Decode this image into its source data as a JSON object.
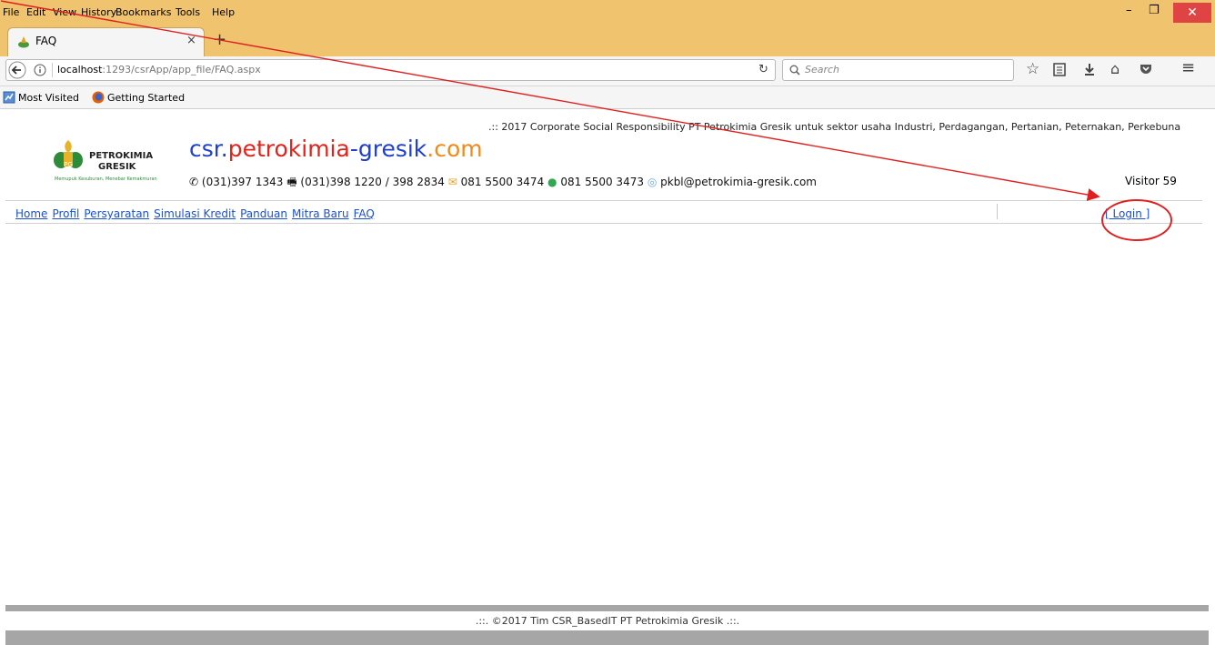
{
  "menubar": {
    "items": [
      "File",
      "Edit",
      "View",
      "History",
      "Bookmarks",
      "Tools",
      "Help"
    ]
  },
  "tab": {
    "title": "FAQ"
  },
  "urlbar": {
    "host": "localhost",
    "path": ":1293/csrApp/app_file/FAQ.aspx"
  },
  "search": {
    "placeholder": "Search"
  },
  "bookmarks": {
    "items": [
      "Most Visited",
      "Getting Started"
    ]
  },
  "page": {
    "tagline": ".:: 2017 Corporate Social Responsibility PT Petrokimia Gresik untuk sektor usaha Industri, Perdagangan, Pertanian, Peternakan, Perkebuna",
    "logo": {
      "line1": "PETROKIMIA",
      "line2": "GRESIK",
      "motto": "Memupuk Kesuburan, Menebar Kemakmuran",
      "badge": "PG"
    },
    "brand": {
      "part1": "csr.",
      "part2": "petrokimia",
      "part3": "-",
      "part4": "gresik",
      "part5": ".com"
    },
    "contacts": {
      "phone": "(031)397 1343",
      "fax": "(031)398 1220 / 398 2834",
      "sms": "081 5500 3474",
      "whatsapp": "081 5500 3473",
      "email": "pkbl@petrokimia-gresik.com"
    },
    "visitor": "Visitor 59",
    "nav": [
      "Home",
      "Profil",
      "Persyaratan",
      "Simulasi Kredit",
      "Panduan",
      "Mitra Baru",
      "FAQ"
    ],
    "login": "[ Login ]",
    "footer": ".::. ©2017 Tim CSR_BasedIT PT Petrokimia Gresik .::."
  },
  "colors": {
    "chrome": "#f0c46f",
    "link": "#1a4fd6",
    "brand_red": "#e0231b",
    "brand_blue": "#1f40c8",
    "brand_orange": "#f08a1a",
    "annotation": "#e02020"
  }
}
